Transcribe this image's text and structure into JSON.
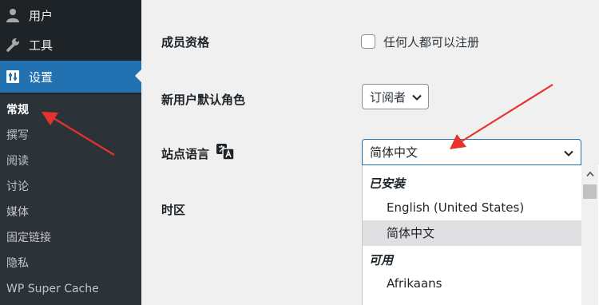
{
  "sidebar": {
    "items": [
      {
        "label": "用户",
        "icon": "user-icon"
      },
      {
        "label": "工具",
        "icon": "wrench-icon"
      },
      {
        "label": "设置",
        "icon": "settings-icon",
        "current": true
      }
    ],
    "submenu": [
      {
        "label": "常规",
        "current": true
      },
      {
        "label": "撰写"
      },
      {
        "label": "阅读"
      },
      {
        "label": "讨论"
      },
      {
        "label": "媒体"
      },
      {
        "label": "固定链接"
      },
      {
        "label": "隐私"
      },
      {
        "label": "WP Super Cache"
      }
    ]
  },
  "settings": {
    "membership": {
      "label": "成员资格",
      "checkbox_text": "任何人都可以注册",
      "checked": false
    },
    "default_role": {
      "label": "新用户默认角色",
      "value": "订阅者"
    },
    "site_language": {
      "label": "站点语言",
      "value": "简体中文",
      "icon": "translation-icon"
    },
    "timezone": {
      "label": "时区"
    }
  },
  "language_dropdown": {
    "groups": [
      {
        "label": "已安装",
        "options": [
          "English (United States)",
          "简体中文"
        ]
      },
      {
        "label": "可用",
        "options": [
          "Afrikaans"
        ]
      }
    ],
    "highlighted": "简体中文"
  },
  "colors": {
    "sidebar_bg": "#1d2327",
    "submenu_bg": "#2c3338",
    "accent": "#2271b1",
    "annotation_arrow": "#e5322d"
  }
}
